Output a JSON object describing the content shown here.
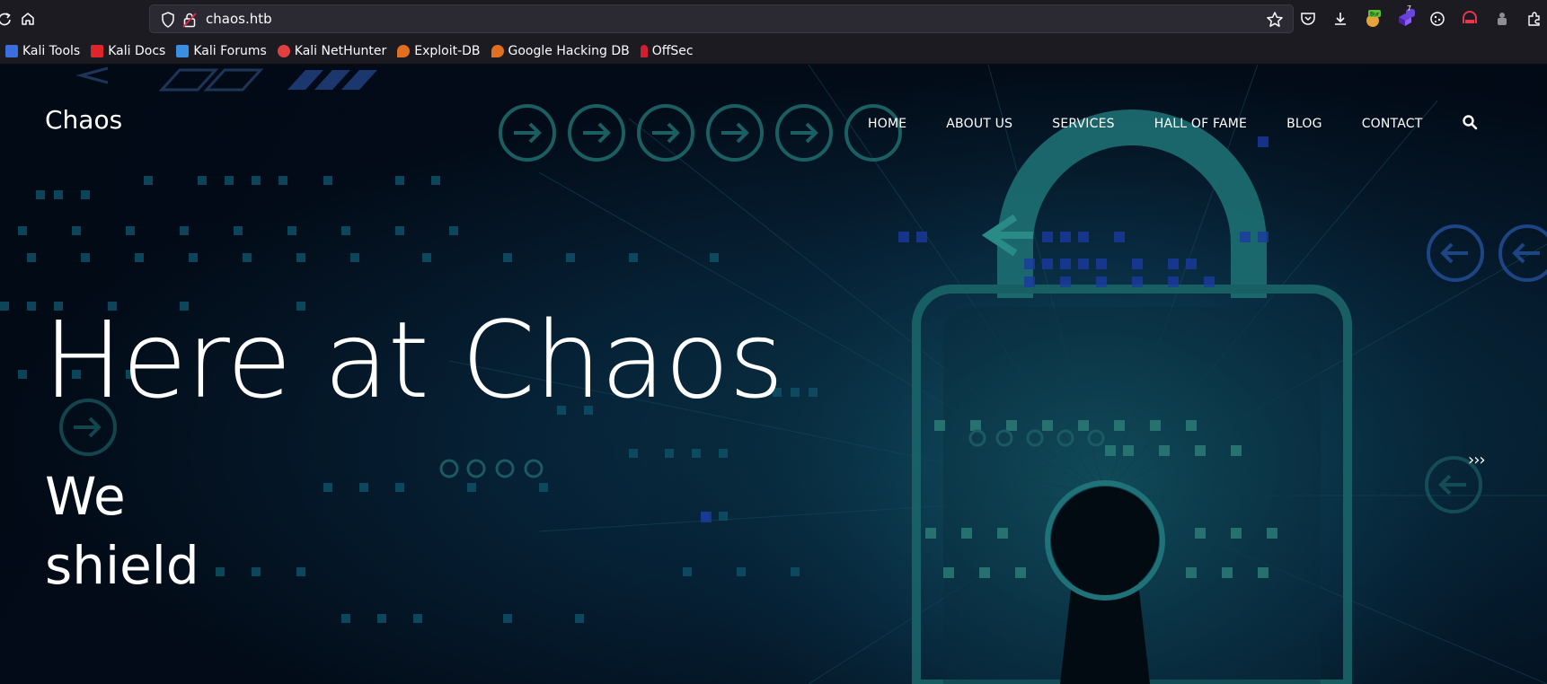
{
  "browser": {
    "url": "chaos.htb",
    "extension_badge": "7",
    "bookmarks": [
      {
        "label": "Kali Tools",
        "color": "#3b6fe0"
      },
      {
        "label": "Kali Docs",
        "color": "#e0252a"
      },
      {
        "label": "Kali Forums",
        "color": "#3b8fe0"
      },
      {
        "label": "Kali NetHunter",
        "color": "#e04040"
      },
      {
        "label": "Exploit-DB",
        "color": "#e07020"
      },
      {
        "label": "Google Hacking DB",
        "color": "#e07020"
      },
      {
        "label": "OffSec",
        "color": "#d02030"
      }
    ],
    "icons": [
      "shield-icon",
      "lock-icon",
      "star-icon",
      "pocket-icon",
      "download-icon",
      "burp-extension-icon",
      "extension-badge-icon",
      "cookie-icon",
      "container-icon",
      "puzzle-icon",
      "extensions-icon",
      "home-icon"
    ]
  },
  "site": {
    "brand": "Chaos",
    "nav": [
      "HOME",
      "ABOUT US",
      "SERVICES",
      "HALL OF FAME",
      "BLOG",
      "CONTACT"
    ],
    "hero_title": "Here at Chaos",
    "hero_sub_line1": "We",
    "hero_sub_line2": "shield",
    "slider_next": "›››"
  },
  "colors": {
    "accent": "#2ab5b5",
    "page_bg": "#051422",
    "chrome_bg": "#1c1b22"
  }
}
